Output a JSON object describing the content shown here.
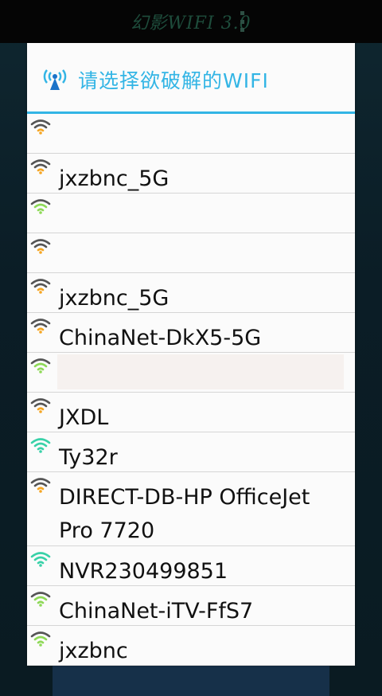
{
  "app": {
    "title": "幻影WIFI 3.0"
  },
  "dialog": {
    "title": "请选择欲破解的WIFI"
  },
  "colors": {
    "accent": "#33b5e5",
    "signal_orange": "#f5a623",
    "signal_green": "#8ed957",
    "signal_teal": "#38d1a8",
    "signal_gray": "#555555"
  },
  "networks": [
    {
      "ssid": "",
      "icon": "wifi-signal-icon",
      "signal": "weak"
    },
    {
      "ssid": "jxzbnc_5G",
      "icon": "wifi-signal-icon",
      "signal": "weak"
    },
    {
      "ssid": "",
      "icon": "wifi-signal-icon",
      "signal": "good"
    },
    {
      "ssid": "",
      "icon": "wifi-signal-icon",
      "signal": "weak"
    },
    {
      "ssid": "jxzbnc_5G",
      "icon": "wifi-signal-icon",
      "signal": "weak"
    },
    {
      "ssid": "ChinaNet-DkX5-5G",
      "icon": "wifi-signal-icon",
      "signal": "weak"
    },
    {
      "ssid": "",
      "icon": "wifi-signal-icon",
      "signal": "good"
    },
    {
      "ssid": "JXDL",
      "icon": "wifi-signal-icon",
      "signal": "weak"
    },
    {
      "ssid": "Ty32r",
      "icon": "wifi-signal-icon",
      "signal": "strong"
    },
    {
      "ssid": "DIRECT-DB-HP OfficeJet Pro 7720",
      "icon": "wifi-signal-icon",
      "signal": "weak"
    },
    {
      "ssid": "NVR230499851",
      "icon": "wifi-signal-icon",
      "signal": "strong"
    },
    {
      "ssid": "ChinaNet-iTV-FfS7",
      "icon": "wifi-signal-icon",
      "signal": "good"
    },
    {
      "ssid": "jxzbnc",
      "icon": "wifi-signal-icon",
      "signal": "good"
    }
  ]
}
